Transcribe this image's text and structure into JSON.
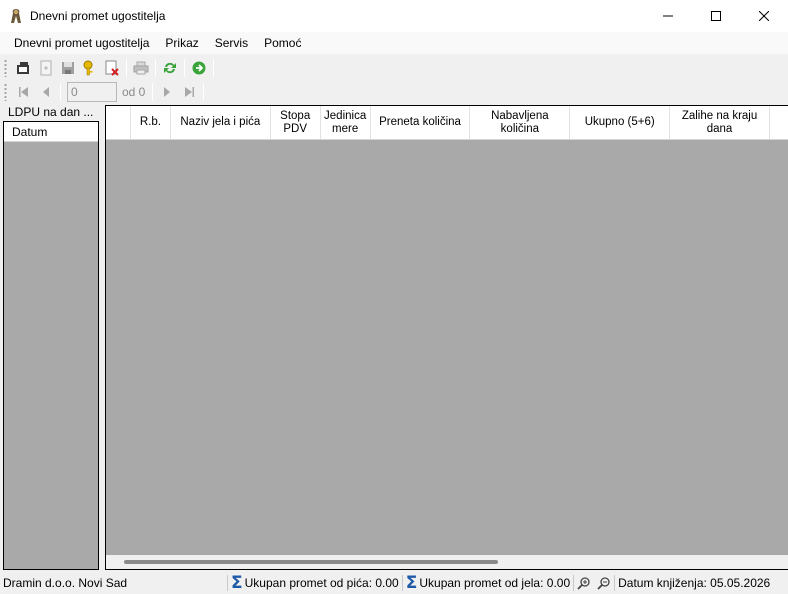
{
  "window": {
    "title": "Dnevni promet ugostitelja"
  },
  "menu": {
    "items": [
      "Dnevni promet ugostitelja",
      "Prikaz",
      "Servis",
      "Pomoć"
    ]
  },
  "navigator": {
    "position": "0",
    "of_label": "od 0"
  },
  "left_panel": {
    "title": "LDPU na dan ...",
    "column": "Datum"
  },
  "grid": {
    "columns": [
      {
        "label": ""
      },
      {
        "label": "R.b."
      },
      {
        "label": "Naziv jela i pića"
      },
      {
        "label": "Stopa PDV"
      },
      {
        "label": "Jedinica mere"
      },
      {
        "label": "Preneta količina"
      },
      {
        "label": "Nabavljena količina"
      },
      {
        "label": "Ukupno (5+6)"
      },
      {
        "label": "Zalihe na kraju dana"
      },
      {
        "label": ""
      }
    ]
  },
  "status": {
    "company": "Dramin d.o.o. Novi Sad",
    "drinks_total": "Ukupan promet od pića: 0.00",
    "food_total": "Ukupan promet od jela: 0.00",
    "date": "Datum knjiženja: 05.05.2026"
  }
}
